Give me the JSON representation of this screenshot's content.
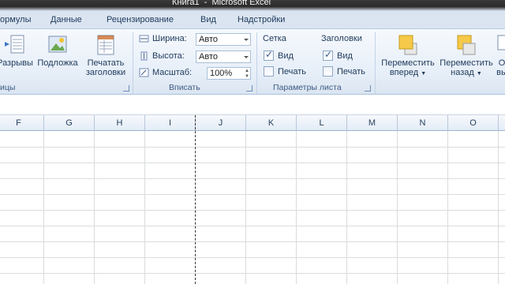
{
  "window": {
    "title": "Книга1  -  Microsoft Excel"
  },
  "tabs": [
    "ормулы",
    "Данные",
    "Рецензирование",
    "Вид",
    "Надстройки"
  ],
  "ribbon": {
    "page_setup_group": {
      "label": "ицы",
      "breaks_label": "Разрывы",
      "background_label": "Подложка",
      "print_titles_label_1": "Печатать",
      "print_titles_label_2": "заголовки"
    },
    "fit_group": {
      "label": "Вписать",
      "width_label": "Ширина:",
      "width_value": "Авто",
      "height_label": "Высота:",
      "height_value": "Авто",
      "scale_label": "Масштаб:",
      "scale_value": "100%"
    },
    "sheet_options_group": {
      "label": "Параметры листа",
      "gridlines_title": "Сетка",
      "gridlines_view_label": "Вид",
      "gridlines_view_checked": true,
      "gridlines_print_label": "Печать",
      "gridlines_print_checked": false,
      "headings_title": "Заголовки",
      "headings_view_label": "Вид",
      "headings_view_checked": true,
      "headings_print_label": "Печать",
      "headings_print_checked": false
    },
    "arrange_group": {
      "bring_forward_1": "Переместить",
      "bring_forward_2": "вперед",
      "send_backward_1": "Переместить",
      "send_backward_2": "назад",
      "selection_pane_partial": "О",
      "selection_pane_partial_2": "вы"
    }
  },
  "grid": {
    "columns": [
      "F",
      "G",
      "H",
      "I",
      "J",
      "K",
      "L",
      "M",
      "N",
      "O"
    ]
  },
  "colors": {
    "ribbon_bg": "#e6eef8",
    "header_text": "#1e395b",
    "page_break": "#333333"
  }
}
